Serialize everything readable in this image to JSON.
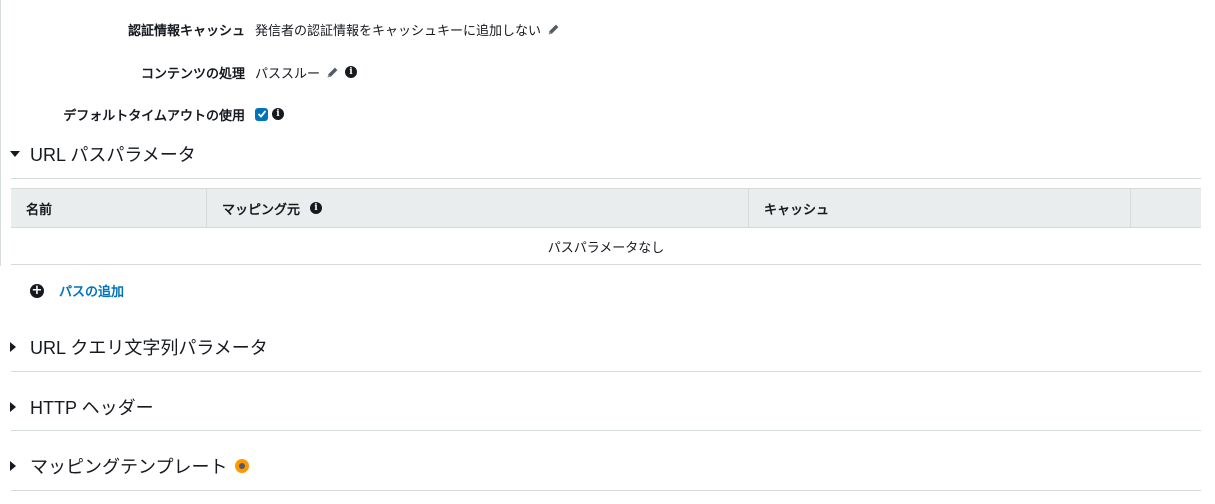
{
  "settings": {
    "credentials_cache": {
      "label": "認証情報キャッシュ",
      "value": "発信者の認証情報をキャッシュキーに追加しない"
    },
    "content_handling": {
      "label": "コンテンツの処理",
      "value": "パススルー"
    },
    "default_timeout": {
      "label": "デフォルトタイムアウトの使用",
      "checked": true
    }
  },
  "url_path_params": {
    "title": "URL パスパラメータ",
    "expanded": true,
    "columns": [
      "名前",
      "マッピング元",
      "キャッシュ"
    ],
    "empty_text": "パスパラメータなし",
    "add_label": "パスの追加"
  },
  "sections": {
    "query_string": {
      "title": "URL クエリ文字列パラメータ",
      "expanded": false
    },
    "http_headers": {
      "title": "HTTP ヘッダー",
      "expanded": false
    },
    "mapping_templates": {
      "title": "マッピングテンプレート",
      "expanded": false
    }
  },
  "colors": {
    "accent": "#0073bb",
    "indicator": "#ff9900",
    "header_bg": "#eaeded",
    "border": "#d5dbdb"
  },
  "icons": {
    "edit": "pencil-icon",
    "info": "info-icon",
    "add": "plus-circle-icon",
    "status": "status-dot-icon"
  }
}
